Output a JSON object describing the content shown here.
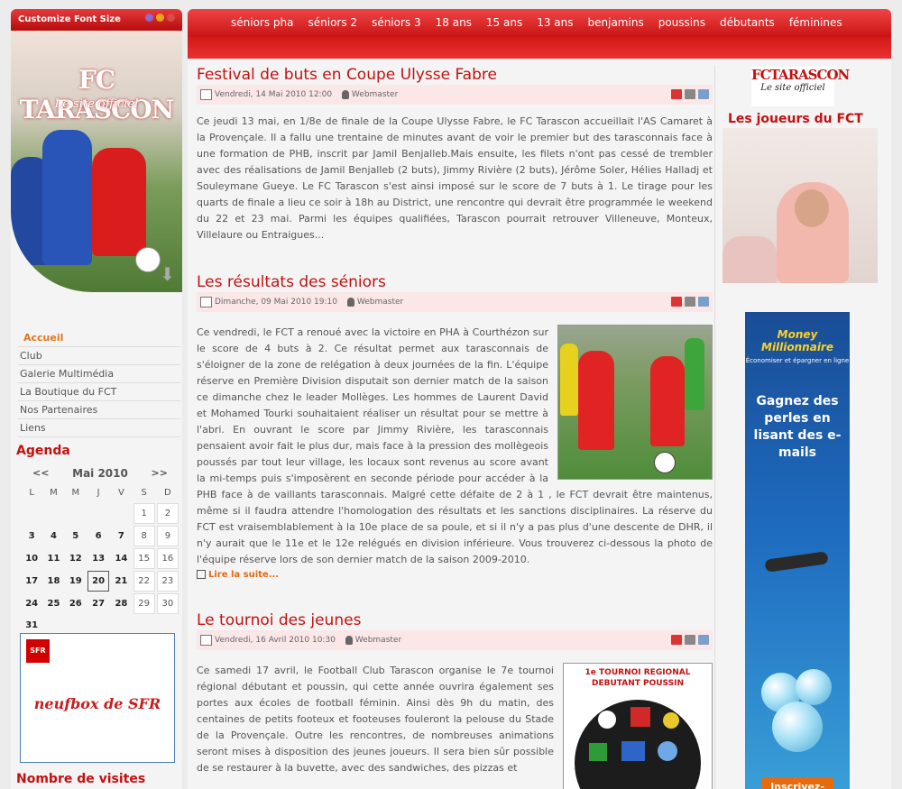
{
  "font_bar": {
    "label": "Customize Font Size"
  },
  "banner": {
    "logo": "FC TARASCON",
    "tagline": "Le site officiel"
  },
  "menu": {
    "items": [
      {
        "label": "Accueil",
        "active": true
      },
      {
        "label": "Club"
      },
      {
        "label": "Galerie Multimédia"
      },
      {
        "label": "La Boutique du FCT"
      },
      {
        "label": "Nos Partenaires"
      },
      {
        "label": "Liens"
      }
    ]
  },
  "agenda": {
    "title": "Agenda",
    "prev": "<<",
    "next": ">>",
    "month": "Mai 2010",
    "weekdays": [
      "L",
      "M",
      "M",
      "J",
      "V",
      "S",
      "D"
    ],
    "weeks": [
      [
        "",
        "",
        "",
        "",
        "",
        "1",
        "2"
      ],
      [
        "3",
        "4",
        "5",
        "6",
        "7",
        "8",
        "9"
      ],
      [
        "10",
        "11",
        "12",
        "13",
        "14",
        "15",
        "16"
      ],
      [
        "17",
        "18",
        "19",
        "20",
        "21",
        "22",
        "23"
      ],
      [
        "24",
        "25",
        "26",
        "27",
        "28",
        "29",
        "30"
      ],
      [
        "31",
        "",
        "",
        "",
        "",
        "",
        ""
      ]
    ],
    "today": "20"
  },
  "sfr_ad": {
    "logo": "SFR",
    "text": "neufbox de SFR"
  },
  "visits_title": "Nombre de visites",
  "topnav": [
    "séniors pha",
    "séniors 2",
    "séniors 3",
    "18 ans",
    "15 ans",
    "13 ans",
    "benjamins",
    "poussins",
    "débutants",
    "féminines"
  ],
  "articles": [
    {
      "title": "Festival de buts en Coupe Ulysse Fabre",
      "date": "Vendredi, 14 Mai 2010 12:00",
      "author": "Webmaster",
      "text": "Ce jeudi 13 mai, en 1/8e de finale de la Coupe Ulysse Fabre, le FC Tarascon accueillait l'AS Camaret à la Provençale. Il a fallu une trentaine de minutes avant de voir le premier but des tarasconnais face à une formation de PHB, inscrit par Jamil Benjalleb.Mais ensuite, les filets n'ont pas cessé de trembler avec des réalisations de Jamil Benjalleb (2 buts), Jimmy Rivière (2 buts), Jérôme Soler, Hélies Halladj et Souleymane Gueye. Le FC Tarascon s'est ainsi imposé sur le score de 7 buts à 1. Le tirage pour les quarts de finale a lieu ce soir à 18h au District, une rencontre qui devrait être programmée le weekend du 22 et 23 mai. Parmi les équipes qualifiées, Tarascon pourrait retrouver Villeneuve, Monteux, Villelaure ou Entraigues..."
    },
    {
      "title": "Les résultats des séniors",
      "date": "Dimanche, 09 Mai 2010 19:10",
      "author": "Webmaster",
      "text": "Ce vendredi, le FCT a renoué avec la victoire en PHA à Courthézon sur le score de 4 buts à 2. Ce résultat permet aux tarasconnais de s'éloigner de la zone de relégation à deux journées de la fin. L'équipe réserve en Première Division disputait son dernier match de la saison ce dimanche chez le leader Mollèges. Les hommes de Laurent David et Mohamed Tourki souhaitaient réaliser un résultat pour se mettre à l'abri. En ouvrant le score par Jimmy Rivière, les tarasconnais pensaient avoir fait le plus dur, mais face à la pression des mollègeois poussés par tout leur village, les locaux sont revenus au score avant la mi-temps puis s'imposèrent en seconde période pour accéder à la PHB face à de vaillants tarasconnais. Malgré cette défaite de 2 à 1 , le FCT devrait être maintenus, même si il faudra attendre l'homologation des résultats et les sanctions disciplinaires. La réserve du FCT est vraisemblablement à la 10e place de sa poule, et si il n'y a pas plus d'une descente de DHR, il n'y aurait que le 11e et le 12e relégués en division inférieure. Vous trouverez ci-dessous la photo de l'équipe réserve lors de son dernier match de la saison 2009-2010.",
      "read_more": "Lire la suite..."
    },
    {
      "title": "Le tournoi des jeunes",
      "date": "Vendredi, 16 Avril 2010 10:30",
      "author": "Webmaster",
      "image_text": "1e TOURNOI REGIONAL DEBUTANT POUSSIN",
      "text": "Ce samedi 17 avril, le Football Club Tarascon organise le 7e tournoi régional débutant et poussin, qui cette année ouvrira également ses portes aux écoles de football féminin. Ainsi dès 9h du matin, des centaines de petits footeux et footeuses fouleront la pelouse du Stade de la Provençale. Outre les rencontres, de nombreuses animations seront mises à disposition des jeunes joueurs. Il sera bien sûr possible de se restaurer à la buvette, avec des sandwiches, des pizzas et"
    }
  ],
  "right": {
    "logo": "FCTARASCON",
    "logo_tagline": "Le site officiel",
    "players_title": "Les joueurs du FCT"
  },
  "ad": {
    "brand": "Money Millionnaire",
    "tagline": "Économiser et épargner en ligne",
    "message": "Gagnez des perles en lisant des e-mails",
    "cta": "Inscrivez-"
  }
}
